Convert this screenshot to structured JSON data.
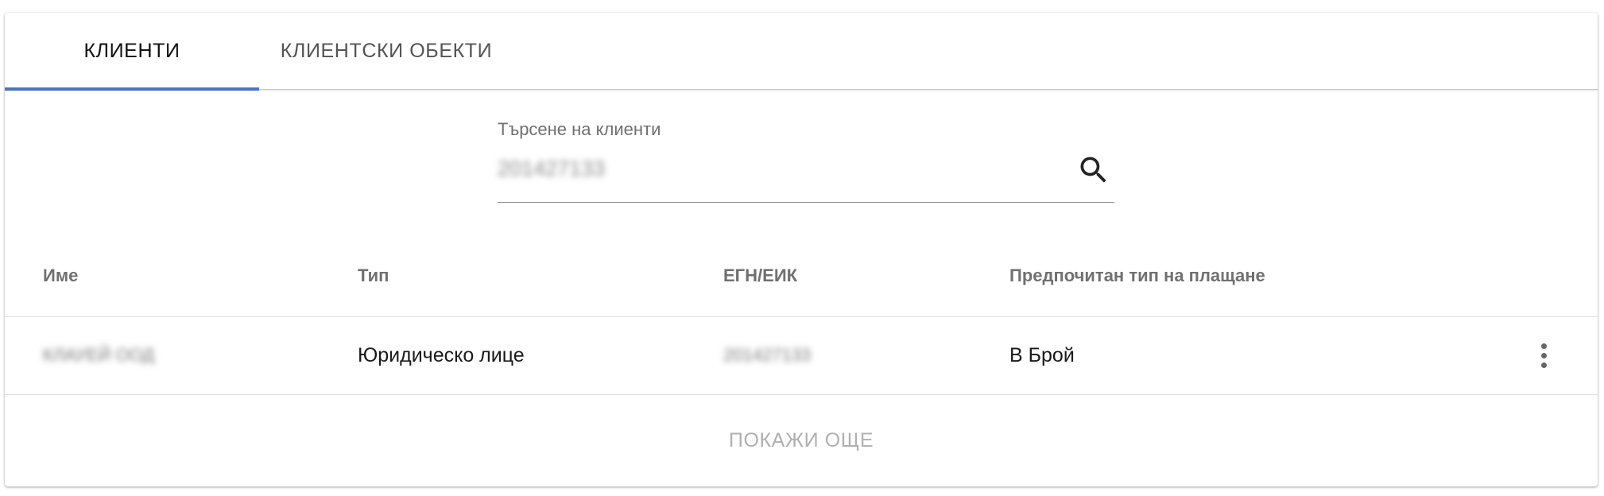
{
  "tabs": [
    {
      "label": "КЛИЕНТИ",
      "active": true
    },
    {
      "label": "КЛИЕНТСКИ ОБЕКТИ",
      "active": false
    }
  ],
  "colors": {
    "accent": "#4a74c9",
    "text": "#1a1a1a",
    "muted": "#707070"
  },
  "search": {
    "label": "Търсене на клиенти",
    "value": "201427133",
    "icon": "search-icon"
  },
  "table": {
    "columns": [
      "Име",
      "Тип",
      "ЕГН/ЕИК",
      "Предпочитан тип на плащане"
    ],
    "rows": [
      {
        "name": "КЛАУЕЙ ООД",
        "type": "Юридическо лице",
        "egn": "201427133",
        "payment": "В Брой",
        "menu_icon": "more-vert-icon"
      }
    ]
  },
  "show_more_label": "ПОКАЖИ ОЩЕ"
}
